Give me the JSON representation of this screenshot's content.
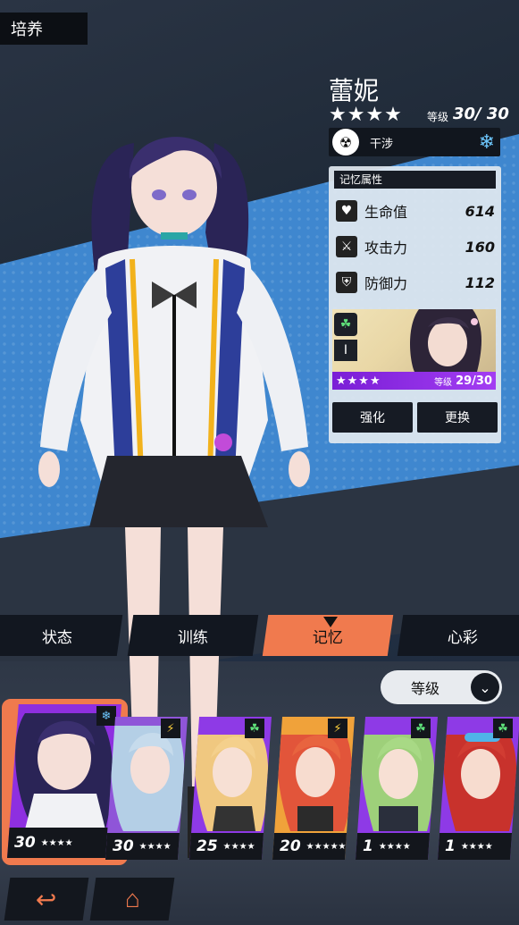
{
  "header": {
    "title": "培养"
  },
  "character": {
    "name": "蕾妮",
    "stars": "★★★★",
    "level_label": "等级",
    "level_value": "30/ 30",
    "role_label": "干涉",
    "role_icon": "interference-icon",
    "element_icon": "snowflake-icon"
  },
  "memory": {
    "header": "记忆属性",
    "stats": [
      {
        "label": "生命值",
        "value": "614",
        "icon": "heart-monitor-icon"
      },
      {
        "label": "攻击力",
        "value": "160",
        "icon": "sword-icon"
      },
      {
        "label": "防御力",
        "value": "112",
        "icon": "shield-icon"
      }
    ],
    "card": {
      "rank": "I",
      "stars": "★★★★",
      "level_label": "等级",
      "level_value": "29/30"
    },
    "buttons": {
      "enhance": "强化",
      "replace": "更换"
    }
  },
  "tabs": [
    {
      "label": "状态",
      "active": false
    },
    {
      "label": "训练",
      "active": false
    },
    {
      "label": "记忆",
      "active": true
    },
    {
      "label": "心彩",
      "active": false
    }
  ],
  "sort": {
    "selected": "等级"
  },
  "roster": [
    {
      "level": "30",
      "stars": "★★★★",
      "element": "snowflake-icon",
      "selected": true
    },
    {
      "level": "30",
      "stars": "★★★★",
      "element": "lightning-icon",
      "selected": false
    },
    {
      "level": "25",
      "stars": "★★★★",
      "element": "leaf-icon",
      "selected": false
    },
    {
      "level": "20",
      "stars": "★★★★★",
      "element": "lightning-icon",
      "selected": false
    },
    {
      "level": "1",
      "stars": "★★★★",
      "element": "leaf-icon",
      "selected": false
    },
    {
      "level": "1",
      "stars": "★★★★",
      "element": "leaf-icon",
      "selected": false
    }
  ],
  "nav": {
    "back_icon": "back-arrow-icon",
    "home_icon": "home-icon"
  },
  "colors": {
    "accent": "#f07a4e",
    "card_purple": "#8e2fe0",
    "panel_dark": "#161b24",
    "bg_blue": "#3f87cf"
  }
}
